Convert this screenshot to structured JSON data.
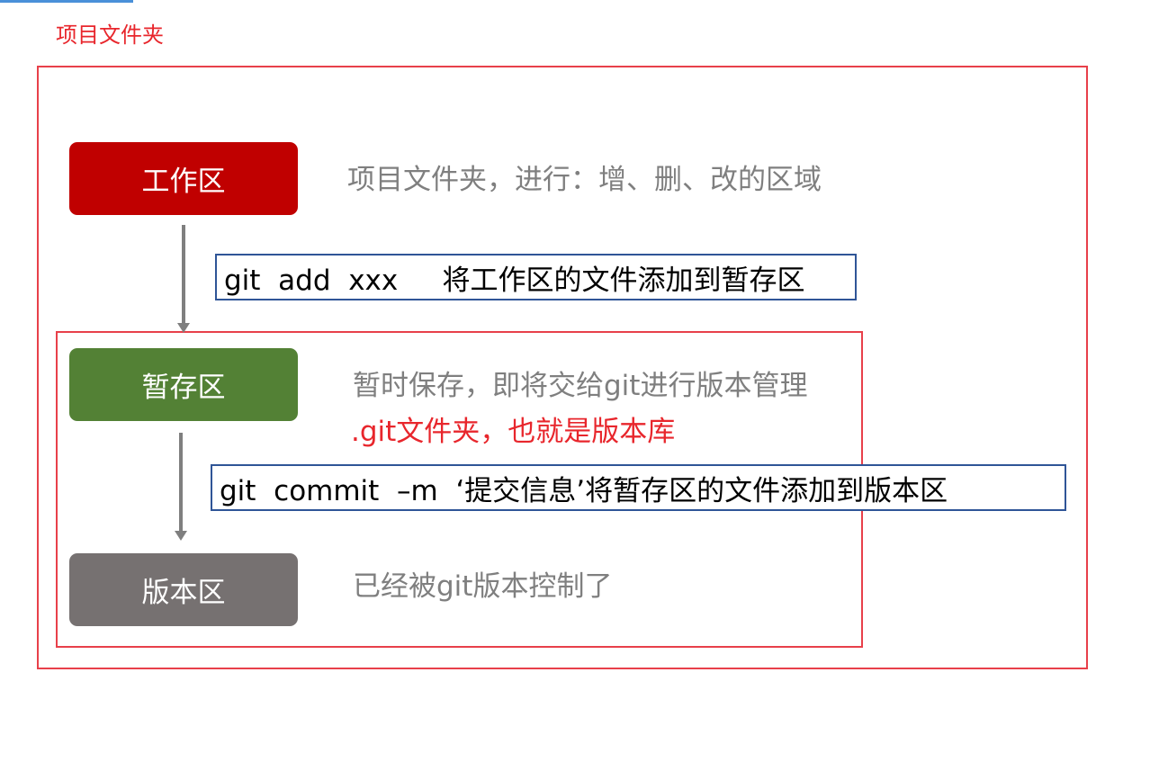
{
  "folder_label": "项目文件夹",
  "zones": {
    "work": {
      "label": "工作区",
      "desc": "项目文件夹，进行：增、删、改的区域"
    },
    "stage": {
      "label": "暂存区",
      "desc": "暂时保存，即将交给git进行版本管理",
      "desc_highlight": ".git文件夹，也就是版本库"
    },
    "repo": {
      "label": "版本区",
      "desc": "已经被git版本控制了"
    }
  },
  "commands": {
    "add": "git  add  xxx     将工作区的文件添加到暂存区",
    "commit": "git  commit  –m  ‘提交信息’将暂存区的文件添加到版本区"
  },
  "colors": {
    "folder_border": "#e8404a",
    "work_zone": "#c00000",
    "stage_zone": "#538135",
    "repo_zone": "#767171",
    "command_border": "#2f5597",
    "highlight_text": "#e8262c",
    "muted_text": "#7f7f7f"
  }
}
